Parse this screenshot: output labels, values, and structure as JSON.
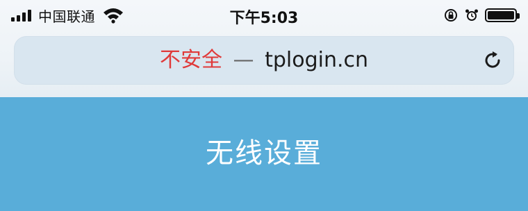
{
  "status_bar": {
    "carrier": "中国联通",
    "time": "下午5:03"
  },
  "address_bar": {
    "security_label": "不安全",
    "separator": "—",
    "url": "tplogin.cn"
  },
  "page": {
    "title": "无线设置"
  },
  "colors": {
    "insecure": "#e03a3a",
    "header_background": "#59add9"
  }
}
